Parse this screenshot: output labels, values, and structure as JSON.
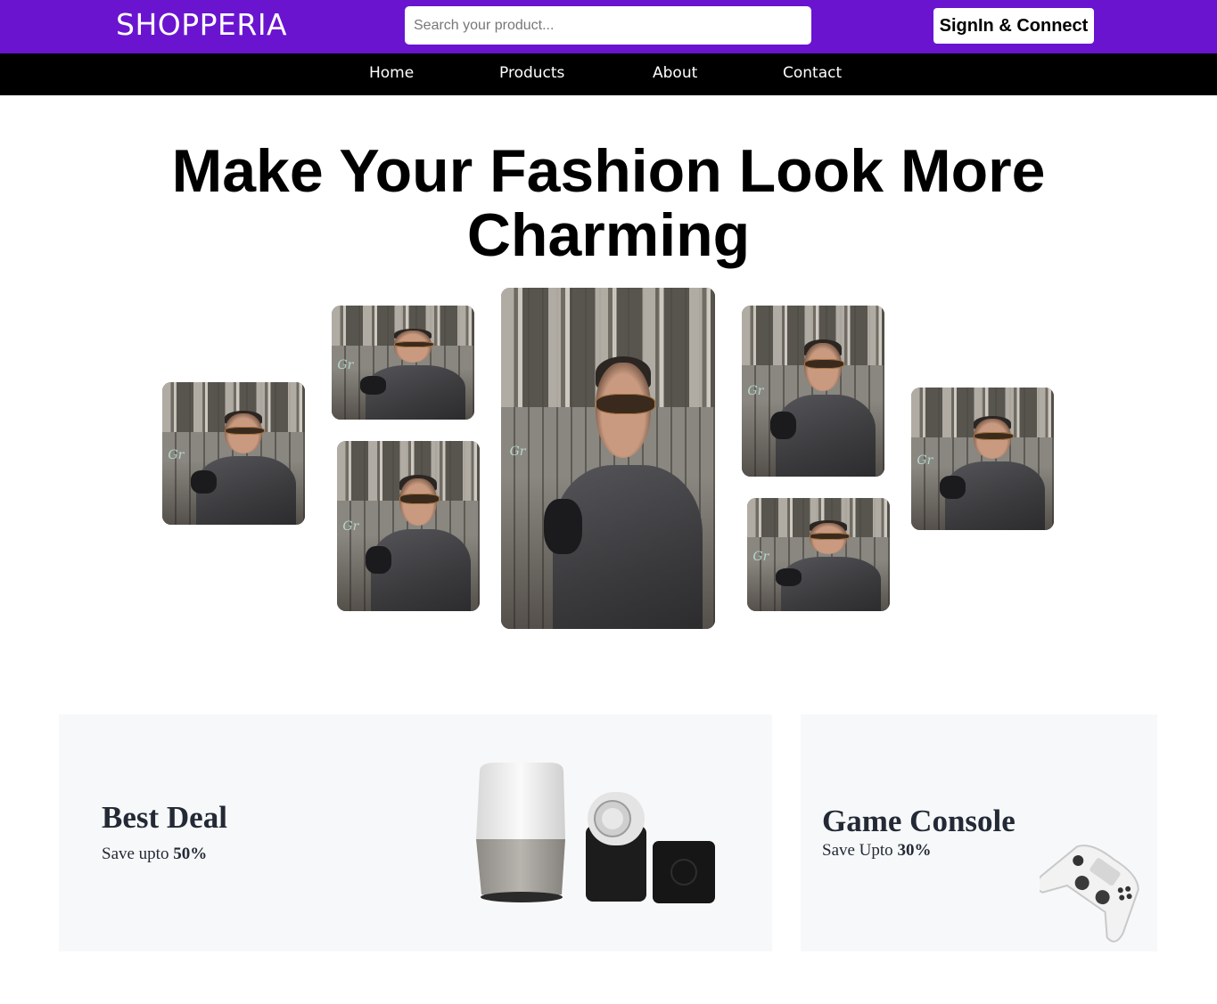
{
  "header": {
    "brand": "SHOPPERIA",
    "search_placeholder": "Search your product...",
    "signin_label": "SignIn & Connect",
    "accent_color": "#6a14d0"
  },
  "nav": {
    "items": [
      {
        "label": "Home"
      },
      {
        "label": "Products"
      },
      {
        "label": "About"
      },
      {
        "label": "Contact"
      }
    ]
  },
  "hero": {
    "title": "Make Your Fashion Look More Charming",
    "gallery_count": 7
  },
  "promos": {
    "best_deal": {
      "title": "Best Deal",
      "sub_prefix": "Save upto ",
      "sub_value": "50%"
    },
    "game_console": {
      "title": "Game Console",
      "sub_prefix": "Save Upto ",
      "sub_value": "30%"
    }
  },
  "icons": {
    "smart_speaker": "smart-speaker-icon",
    "smart_lock": "smart-lock-icon",
    "controller": "game-controller-icon"
  }
}
